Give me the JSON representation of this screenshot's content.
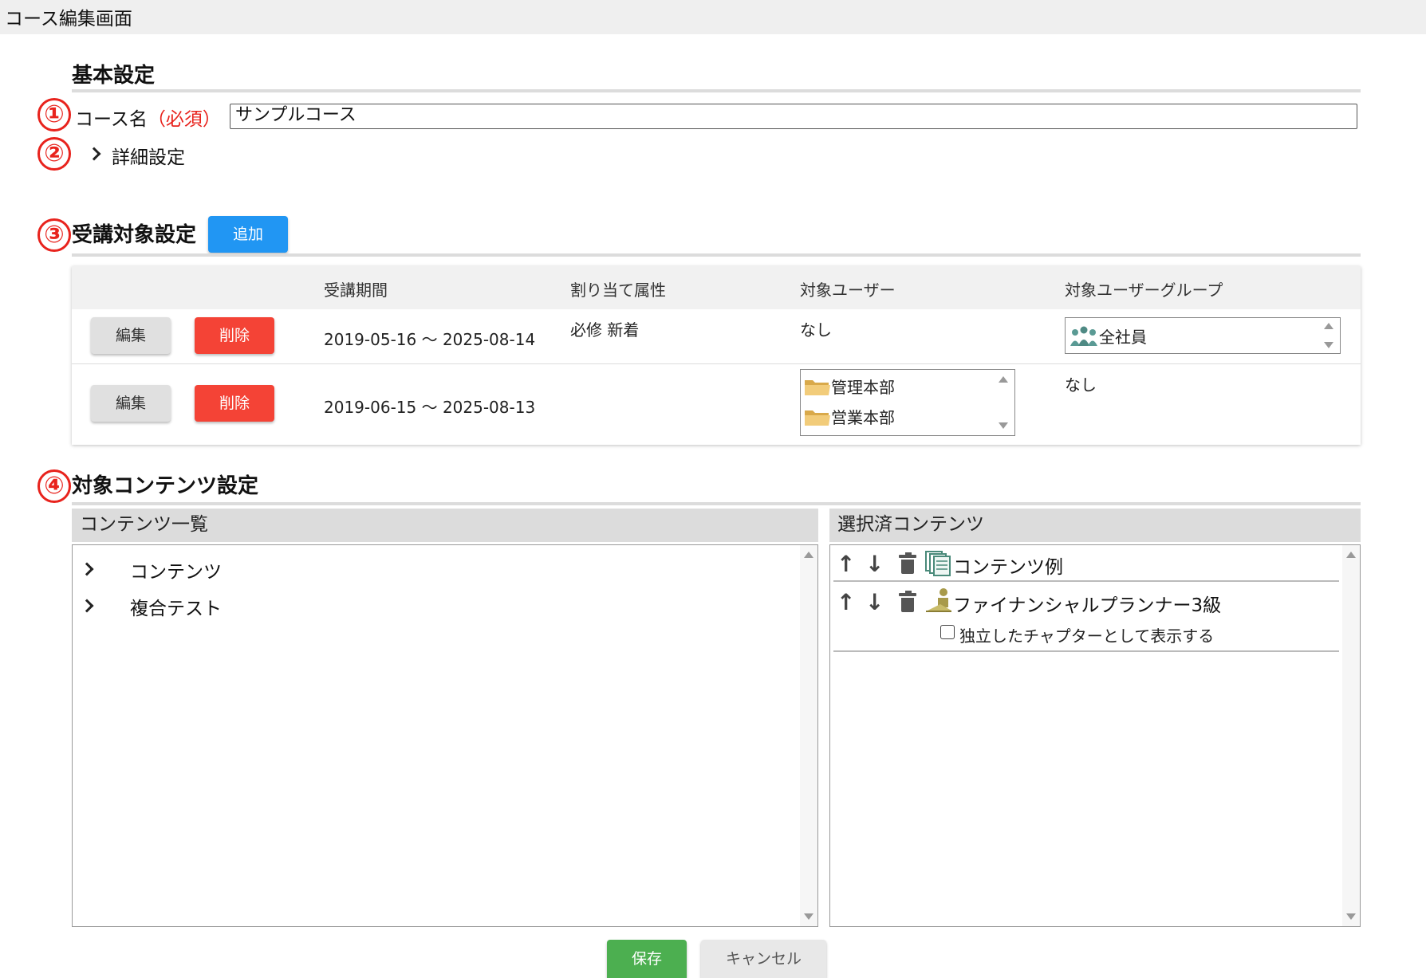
{
  "window": {
    "title": "コース編集画面"
  },
  "markers": [
    "①",
    "②",
    "③",
    "④"
  ],
  "basic": {
    "heading": "基本設定",
    "course_name_label": "コース名",
    "required_label": "（必須）",
    "course_name_value": "サンプルコース",
    "detail_settings_label": "詳細設定"
  },
  "audience": {
    "heading": "受講対象設定",
    "add_button": "追加",
    "columns": [
      "受講期間",
      "割り当て属性",
      "対象ユーザー",
      "対象ユーザーグループ"
    ],
    "edit_label": "編集",
    "delete_label": "削除",
    "rows": [
      {
        "period": "2019-05-16 〜 2025-08-14",
        "attributes": "必修 新着",
        "users": "なし",
        "groups": [
          "全社員"
        ]
      },
      {
        "period": "2019-06-15 〜 2025-08-13",
        "attributes": "",
        "users_list": [
          "管理本部",
          "営業本部"
        ],
        "groups_text": "なし"
      }
    ]
  },
  "content": {
    "heading": "対象コンテンツ設定",
    "list_title": "コンテンツ一覧",
    "list_items": [
      "コンテンツ",
      "複合テスト"
    ],
    "selected_title": "選択済コンテンツ",
    "selected_items": [
      {
        "name": "コンテンツ例",
        "icon": "content-pages-icon"
      },
      {
        "name": "ファイナンシャルプランナー3級",
        "icon": "study-person-icon",
        "option": "独立したチャプターとして表示する"
      }
    ]
  },
  "footer": {
    "save_label": "保存",
    "cancel_label": "キャンセル"
  },
  "colors": {
    "accent_blue": "#2196f3",
    "delete_red": "#f44336",
    "save_green": "#4caf50",
    "marker_red": "#e8231d"
  }
}
